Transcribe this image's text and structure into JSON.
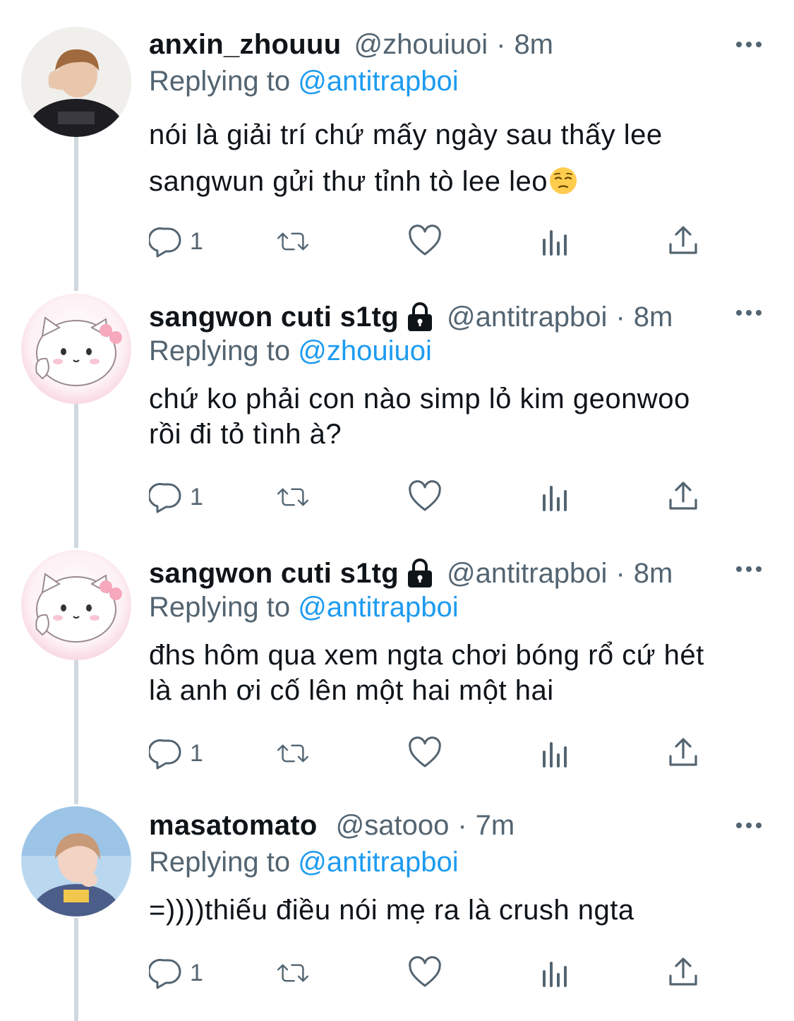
{
  "tweets": [
    {
      "display_name": "anxin_zhouuu",
      "handle": "@zhouiuoi",
      "separator": "·",
      "time": "8m",
      "locked": false,
      "replying_prefix": "Replying to",
      "replying_to": "@antitrapboi",
      "text_lines": [
        "nói là giải trí chứ mấy ngày sau thấy lee",
        "sangwun gửi thư tỉnh tò lee leo"
      ],
      "emoji": "pensive-face",
      "reply_count": "1"
    },
    {
      "display_name": "sangwon cuti s1tg",
      "handle": "@antitrapboi",
      "separator": "·",
      "time": "8m",
      "locked": true,
      "replying_prefix": "Replying to",
      "replying_to": "@zhouiuoi",
      "text_lines": [
        "chứ ko phải con nào simp lỏ kim geonwoo",
        "rồi đi tỏ tình à?"
      ],
      "reply_count": "1"
    },
    {
      "display_name": "sangwon cuti s1tg",
      "handle": "@antitrapboi",
      "separator": "·",
      "time": "8m",
      "locked": true,
      "replying_prefix": "Replying to",
      "replying_to": "@antitrapboi",
      "text_lines": [
        "đhs hôm qua xem ngta chơi bóng rổ cứ hét",
        "là anh ơi cố lên một hai một hai"
      ],
      "reply_count": "1"
    },
    {
      "display_name": "masatomato",
      "handle": "@satooo",
      "separator": "·",
      "time": "7m",
      "locked": false,
      "replying_prefix": "Replying to",
      "replying_to": "@antitrapboi",
      "text_lines": [
        "=))))thiếu điều nói mẹ ra là crush ngta"
      ],
      "reply_count": "1"
    }
  ],
  "colors": {
    "text": "#0f1419",
    "secondary": "#536471",
    "link": "#1d9bf0",
    "thread_line": "#cfd9de"
  },
  "icons": [
    "reply-icon",
    "retweet-icon",
    "like-icon",
    "analytics-icon",
    "share-icon",
    "more-icon",
    "lock-icon"
  ]
}
